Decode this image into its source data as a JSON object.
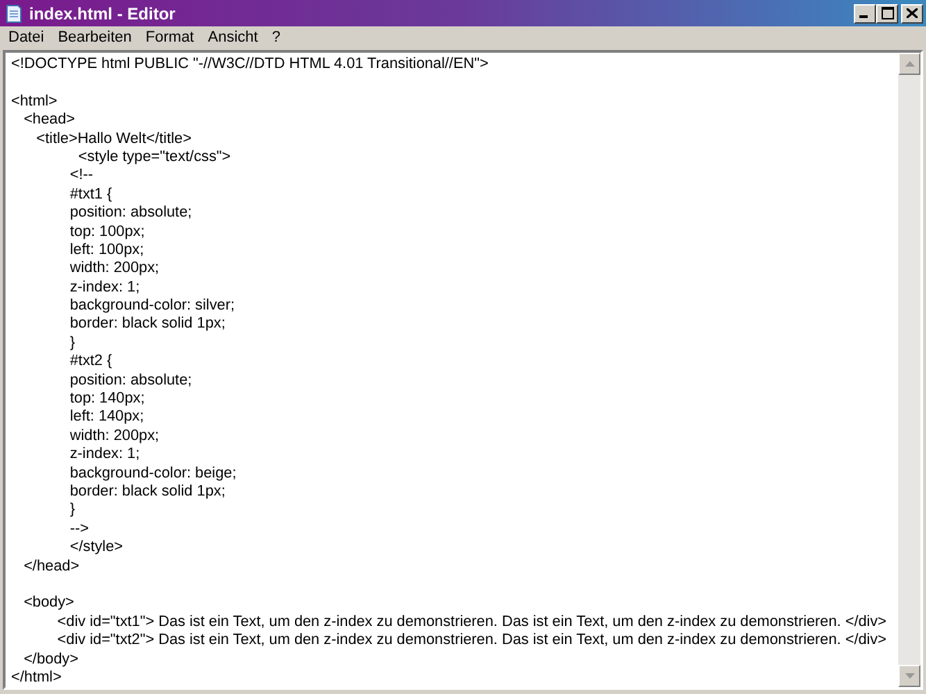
{
  "window": {
    "title": "index.html - Editor"
  },
  "menu": [
    "Datei",
    "Bearbeiten",
    "Format",
    "Ansicht",
    "?"
  ],
  "editor": {
    "lines": [
      {
        "text": "<!DOCTYPE html PUBLIC \"-//W3C//DTD HTML 4.01 Transitional//EN\">"
      },
      {
        "text": "<html>",
        "blank_line_before": true
      },
      {
        "text": "   <head>"
      },
      {
        "text": "      <title>Hallo Welt</title>"
      },
      {
        "text": "                <style type=\"text/css\">"
      },
      {
        "text": "              <!--"
      },
      {
        "text": "              #txt1 {"
      },
      {
        "text": "              position: absolute;"
      },
      {
        "text": "              top: 100px;"
      },
      {
        "text": "              left: 100px;"
      },
      {
        "text": "              width: 200px;"
      },
      {
        "text": "              z-index: 1;"
      },
      {
        "text": "              background-color: silver;"
      },
      {
        "text": "              border: black solid 1px;"
      },
      {
        "text": "              }"
      },
      {
        "text": "              #txt2 {"
      },
      {
        "text": "              position: absolute;"
      },
      {
        "text": "              top: 140px;"
      },
      {
        "text": "              left: 140px;"
      },
      {
        "text": "              width: 200px;"
      },
      {
        "text": "              z-index: 1;"
      },
      {
        "text": "              background-color: beige;"
      },
      {
        "text": "              border: black solid 1px;"
      },
      {
        "text": "              }"
      },
      {
        "text": "              -->"
      },
      {
        "text": "              </style>"
      },
      {
        "text": "   </head>"
      },
      {
        "text": "   <body>",
        "blank_line_before": true
      },
      {
        "text": "           <div id=\"txt1\"> Das ist ein Text, um den z-index zu demonstrieren. Das ist ein Text, um den z-index zu demonstrieren. </div>"
      },
      {
        "text": "           <div id=\"txt2\"> Das ist ein Text, um den z-index zu demonstrieren. Das ist ein Text, um den z-index zu demonstrieren. </div>"
      },
      {
        "text": "   </body>"
      },
      {
        "text": "</html>"
      }
    ]
  }
}
